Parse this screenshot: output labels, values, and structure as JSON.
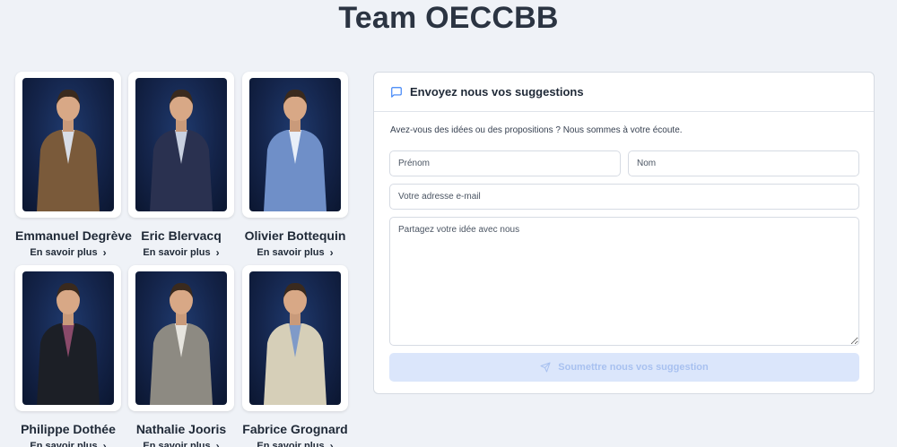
{
  "page": {
    "title": "Team OECCBB"
  },
  "team": {
    "members": [
      {
        "name": "Emmanuel Degrève",
        "link": "En savoir plus",
        "suit": "#7a5a3a",
        "shirt": "#d8dde6"
      },
      {
        "name": "Eric Blervacq",
        "link": "En savoir plus",
        "suit": "#2a3150",
        "shirt": "#c8d0e0"
      },
      {
        "name": "Olivier Bottequin",
        "link": "En savoir plus",
        "suit": "#6f8fc8",
        "shirt": "#e8eef8"
      },
      {
        "name": "Philippe Dothée",
        "link": "En savoir plus",
        "suit": "#1c1f26",
        "shirt": "#8a4a6a"
      },
      {
        "name": "Nathalie Jooris",
        "link": "En savoir plus",
        "suit": "#8d8a82",
        "shirt": "#e6e4de"
      },
      {
        "name": "Fabrice Grognard",
        "link": "En savoir plus",
        "suit": "#d6cfb8",
        "shirt": "#7f9ac8"
      }
    ]
  },
  "form": {
    "title": "Envoyez nous vos suggestions",
    "intro": "Avez-vous des idées ou des propositions ? Nous sommes à votre écoute.",
    "first_name_placeholder": "Prénom",
    "last_name_placeholder": "Nom",
    "email_placeholder": "Votre adresse e-mail",
    "message_placeholder": "Partagez votre idée avec nous",
    "submit_label": "Soumettre nous vos suggestion",
    "icons": {
      "header": "message-square-icon",
      "submit": "send-icon"
    },
    "colors": {
      "accent": "#3b82f6",
      "submit_bg": "#dbe6fb",
      "submit_text": "#a8c1f0"
    }
  }
}
